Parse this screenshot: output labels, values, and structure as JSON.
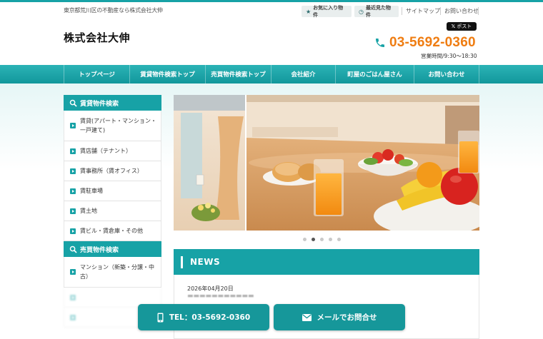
{
  "header": {
    "tagline": "東京都荒川区の不動産なら株式会社大伸",
    "favorites_label": "お気に入り物件",
    "recent_label": "最近見た物件",
    "sitemap_label": "サイトマップ",
    "contact_label": "お問い合わせ",
    "post_label": "ポスト",
    "company_name": "株式会社大伸",
    "phone": "03-5692-0360",
    "hours": "営業時間/9:30～18:30"
  },
  "nav": {
    "items": [
      {
        "label": "トップページ"
      },
      {
        "label": "賃貸物件検索トップ"
      },
      {
        "label": "売買物件検索トップ"
      },
      {
        "label": "会社紹介"
      },
      {
        "label": "町屋のごはん屋さん"
      },
      {
        "label": "お問い合わせ"
      }
    ]
  },
  "sidebar": {
    "rental_title": "賃貸物件検索",
    "rental_items": [
      {
        "label": "賃貸(アパート・マンション・一戸建て)"
      },
      {
        "label": "賃店舗（テナント）"
      },
      {
        "label": "賃事務所（賃オフィス）"
      },
      {
        "label": "賃駐車場"
      },
      {
        "label": "賃土地"
      },
      {
        "label": "賃ビル・賃倉庫・その他"
      }
    ],
    "sale_title": "売買物件検索",
    "sale_items": [
      {
        "label": "マンション（新築・分譲・中古）"
      }
    ]
  },
  "slider": {
    "dots": 5,
    "active_dot": 2
  },
  "news": {
    "title": "NEWS",
    "date": "2026年04月20日"
  },
  "floating": {
    "tel_label": "TEL：03-5692-0360",
    "mail_label": "メールでお問合せ"
  },
  "colors": {
    "accent": "#17a2a6",
    "phone": "#ef7d12"
  }
}
